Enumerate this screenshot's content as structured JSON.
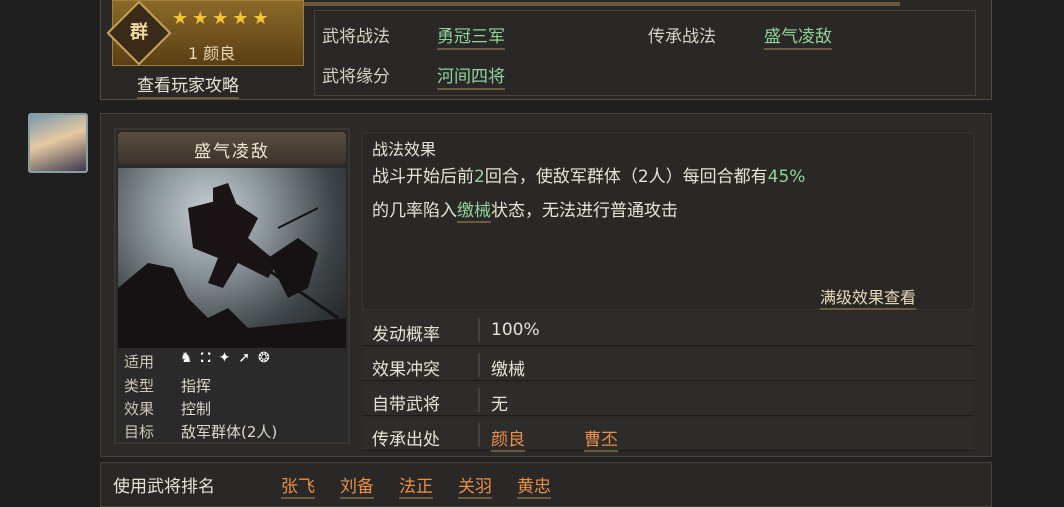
{
  "hero": {
    "faction": "群",
    "stars": "★★★★★",
    "name": "1 颜良",
    "guide_link": "查看玩家攻略"
  },
  "info": {
    "skill_label": "武将战法",
    "skill_value": "勇冠三军",
    "inherit_label": "传承战法",
    "inherit_value": "盛气凌敌",
    "fate_label": "武将缘分",
    "fate_value": "河间四将"
  },
  "card": {
    "title": "盛气凌敌",
    "apply_label": "适用",
    "apply_icons": [
      "cavalry-icon",
      "shield-icon",
      "bow-icon",
      "spear-icon",
      "chariot-icon"
    ],
    "type_label": "类型",
    "type_value": "指挥",
    "effect_label": "效果",
    "effect_value": "控制",
    "target_label": "目标",
    "target_value": "敌军群体(2人)"
  },
  "effect": {
    "title": "战法效果",
    "text_part1": "战斗开始后前",
    "text_rounds": "2",
    "text_part2": "回合，使敌军群体（2人）每回合都有",
    "text_percent": "45%",
    "text_part3": "的几率陷入",
    "text_status": "缴械",
    "text_part4": "状态，无法进行普通攻击",
    "full_link": "满级效果查看"
  },
  "stats": {
    "rate_label": "发动概率",
    "rate_value": "100%",
    "conflict_label": "效果冲突",
    "conflict_value": "缴械",
    "own_label": "自带武将",
    "own_value": "无",
    "source_label": "传承出处",
    "source_values": [
      "颜良",
      "曹丕"
    ]
  },
  "ranking": {
    "label": "使用武将排名",
    "names": [
      "张飞",
      "刘备",
      "法正",
      "关羽",
      "黄忠"
    ]
  },
  "colors": {
    "accent_green": "#8fd49a",
    "accent_orange": "#e89048",
    "gold": "#f5c430"
  }
}
